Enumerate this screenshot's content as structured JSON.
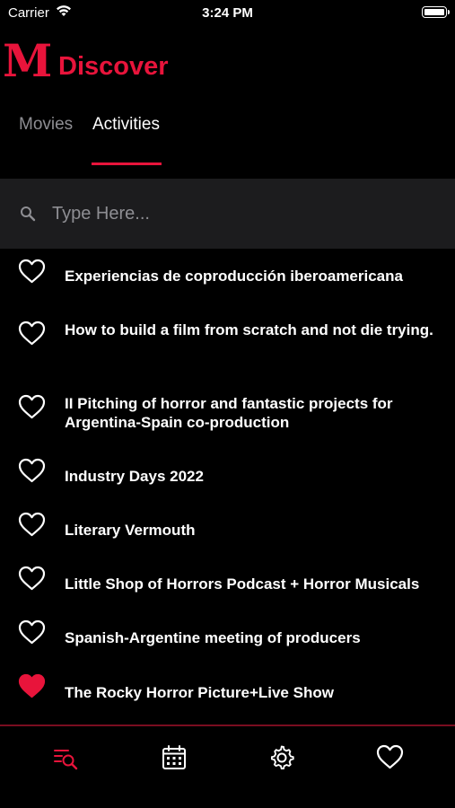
{
  "status": {
    "carrier": "Carrier",
    "time": "3:24 PM"
  },
  "header": {
    "logo": "M",
    "title": "Discover"
  },
  "tabs": [
    {
      "label": "Movies",
      "active": false
    },
    {
      "label": "Activities",
      "active": true
    }
  ],
  "search": {
    "placeholder": "Type Here...",
    "value": ""
  },
  "activities": [
    {
      "title": "Experiencias de coproducción iberoamericana",
      "favorite": false
    },
    {
      "title": "How to build a film from scratch and not die trying.",
      "favorite": false
    },
    {
      "title": "II Pitching of horror and fantastic projects for Argentina-Spain co-production",
      "favorite": false
    },
    {
      "title": "Industry Days 2022",
      "favorite": false
    },
    {
      "title": "Literary Vermouth",
      "favorite": false
    },
    {
      "title": "Little Shop of Horrors Podcast + Horror Musicals",
      "favorite": false
    },
    {
      "title": "Spanish-Argentine meeting of producers",
      "favorite": false
    },
    {
      "title": "The Rocky Horror Picture+Live Show",
      "favorite": true
    }
  ],
  "tabbar": [
    {
      "icon": "search-list-icon",
      "active": true
    },
    {
      "icon": "calendar-icon",
      "active": false
    },
    {
      "icon": "gear-icon",
      "active": false
    },
    {
      "icon": "heart-icon",
      "active": false
    }
  ],
  "colors": {
    "accent": "#e8143b",
    "background": "#000000",
    "searchbar": "#1c1c1e",
    "inactive_tab": "#8e8e93"
  }
}
